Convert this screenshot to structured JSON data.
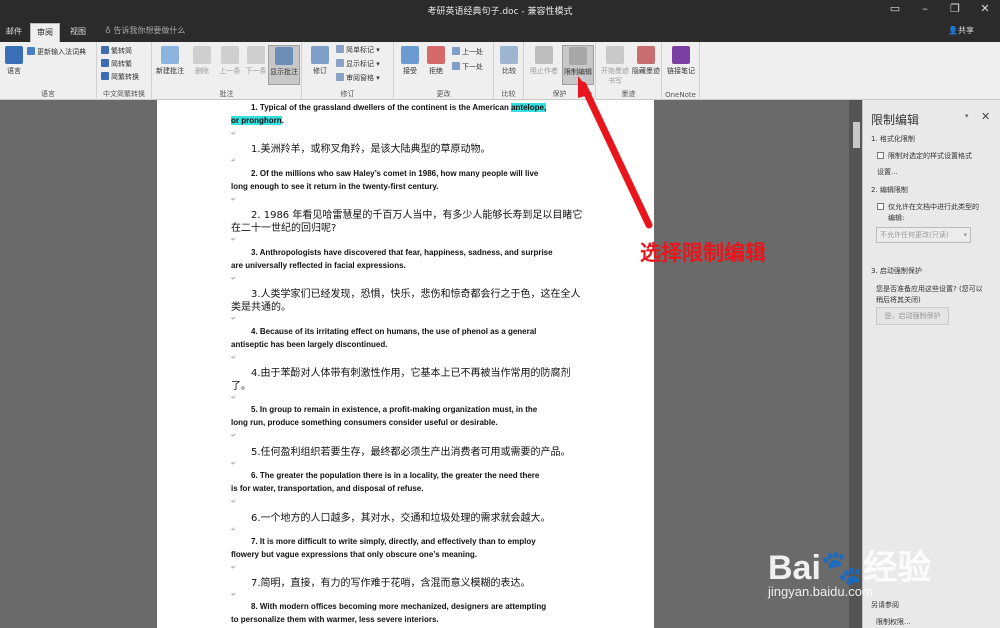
{
  "window": {
    "title": "考研英语经典句子.doc",
    "mode": "兼容性模式"
  },
  "tabs": [
    {
      "label": "邮件"
    },
    {
      "label": "审阅"
    },
    {
      "label": "视图"
    }
  ],
  "tell_me": "告诉我你想要做什么",
  "share_label": "共享",
  "ribbon": {
    "groups": {
      "language": "语言",
      "chinese": "中文简繁转换",
      "comments": "批注",
      "tracking": "修订",
      "changes": "更改",
      "compare": "比较",
      "protect": "保护",
      "ink": "墨迹",
      "onenote": "OneNote"
    },
    "language_btn": "语言",
    "update_ime": "更新输入法词典",
    "to_trad": "繁转简",
    "to_simp": "简转繁",
    "convert": "简繁转换",
    "new_comment": "新建批注",
    "delete": "删除",
    "prev": "上一条",
    "next": "下一条",
    "show_comments": "显示批注",
    "track": "修订",
    "simple_markup": "简单标记",
    "show_markup": "显示标记",
    "review_pane": "审阅窗格",
    "accept": "接受",
    "reject": "拒绝",
    "prev_change": "上一处",
    "next_change": "下一处",
    "compare": "比较",
    "block_authors": "阻止作者",
    "restrict_editing": "限制编辑",
    "start_inking": "开始墨迹书写",
    "hide_ink": "隐藏墨迹",
    "linked_notes": "链接笔记"
  },
  "document": {
    "p1a": "1. Typical of the grassland dwellers of the continent is the American ",
    "p1hl": "antelope,",
    "p1b_hl": "or pronghorn",
    "p1b_end": ".",
    "c1": "1.美洲羚羊，或称叉角羚，是该大陆典型的草原动物。",
    "p2a": "2. Of the millions who saw Haley’s comet in 1986, how many people will live",
    "p2b": "long enough to see it return in the twenty-first century.",
    "c2a": "2. 1986 年看见哈雷慧星的千百万人当中，有多少人能够长寿到足以目睹它",
    "c2b": "在二十一世纪的回归呢?",
    "p3a": "3. Anthropologists have discovered that fear, happiness, sadness, and surprise",
    "p3b": "are universally reflected in facial expressions.",
    "c3a": "3.人类学家们已经发现，恐惧，快乐，悲伤和惊奇都会行之于色，这在全人",
    "c3b": "类是共通的。",
    "p4a": "4. Because of its irritating effect on humans, the use of phenol as a general",
    "p4b": "antiseptic has been largely discontinued.",
    "c4a": "4.由于苯酚对人体带有刺激性作用，它基本上已不再被当作常用的防腐剂",
    "c4b": "了。",
    "p5a": "5. In group to remain in existence, a profit-making organization must, in the",
    "p5b": "long run, produce something consumers consider useful or desirable.",
    "c5": "5.任何盈利组织若要生存，最终都必须生产出消费者可用或需要的产品。",
    "p6a": "6. The greater the population there is in a locality, the greater the need there",
    "p6b": "is for water, transportation, and disposal of refuse.",
    "c6": "6.一个地方的人口越多，其对水，交通和垃圾处理的需求就会越大。",
    "p7a": "7. It is more difficult to write simply, directly, and effectively than to employ",
    "p7b": "flowery but vague expressions that only obscure one’s meaning.",
    "c7": "7.简明，直接，有力的写作难于花哨，含混而意义模糊的表达。",
    "p8a": "8. With modern offices becoming more mechanized, designers are attempting",
    "p8b": "to personalize them with warmer, less severe interiors."
  },
  "panel": {
    "title": "限制编辑",
    "s1": "1. 格式化限制",
    "s1_check": "限制对选定的样式设置格式",
    "s1_link": "设置...",
    "s2": "2. 编辑限制",
    "s2_check_a": "仅允许在文档中进行此类型的",
    "s2_check_b": "编辑:",
    "s2_select": "不允许任何更改(只读)",
    "s3": "3. 启动强制保护",
    "s3_q_a": "您是否准备应用这些设置? (您可以",
    "s3_q_b": "稍后将其关闭)",
    "s3_btn": "是，启动强制保护",
    "see_also": "另请参阅",
    "perm": "限制权限..."
  },
  "annotation": "选择限制编辑",
  "watermark": {
    "logo": "Bai🐾经验",
    "url": "jingyan.baidu.com"
  },
  "colors": {
    "highlight": "#36e0e0",
    "arrow": "#e8161c",
    "onenote": "#7b3fa3"
  }
}
